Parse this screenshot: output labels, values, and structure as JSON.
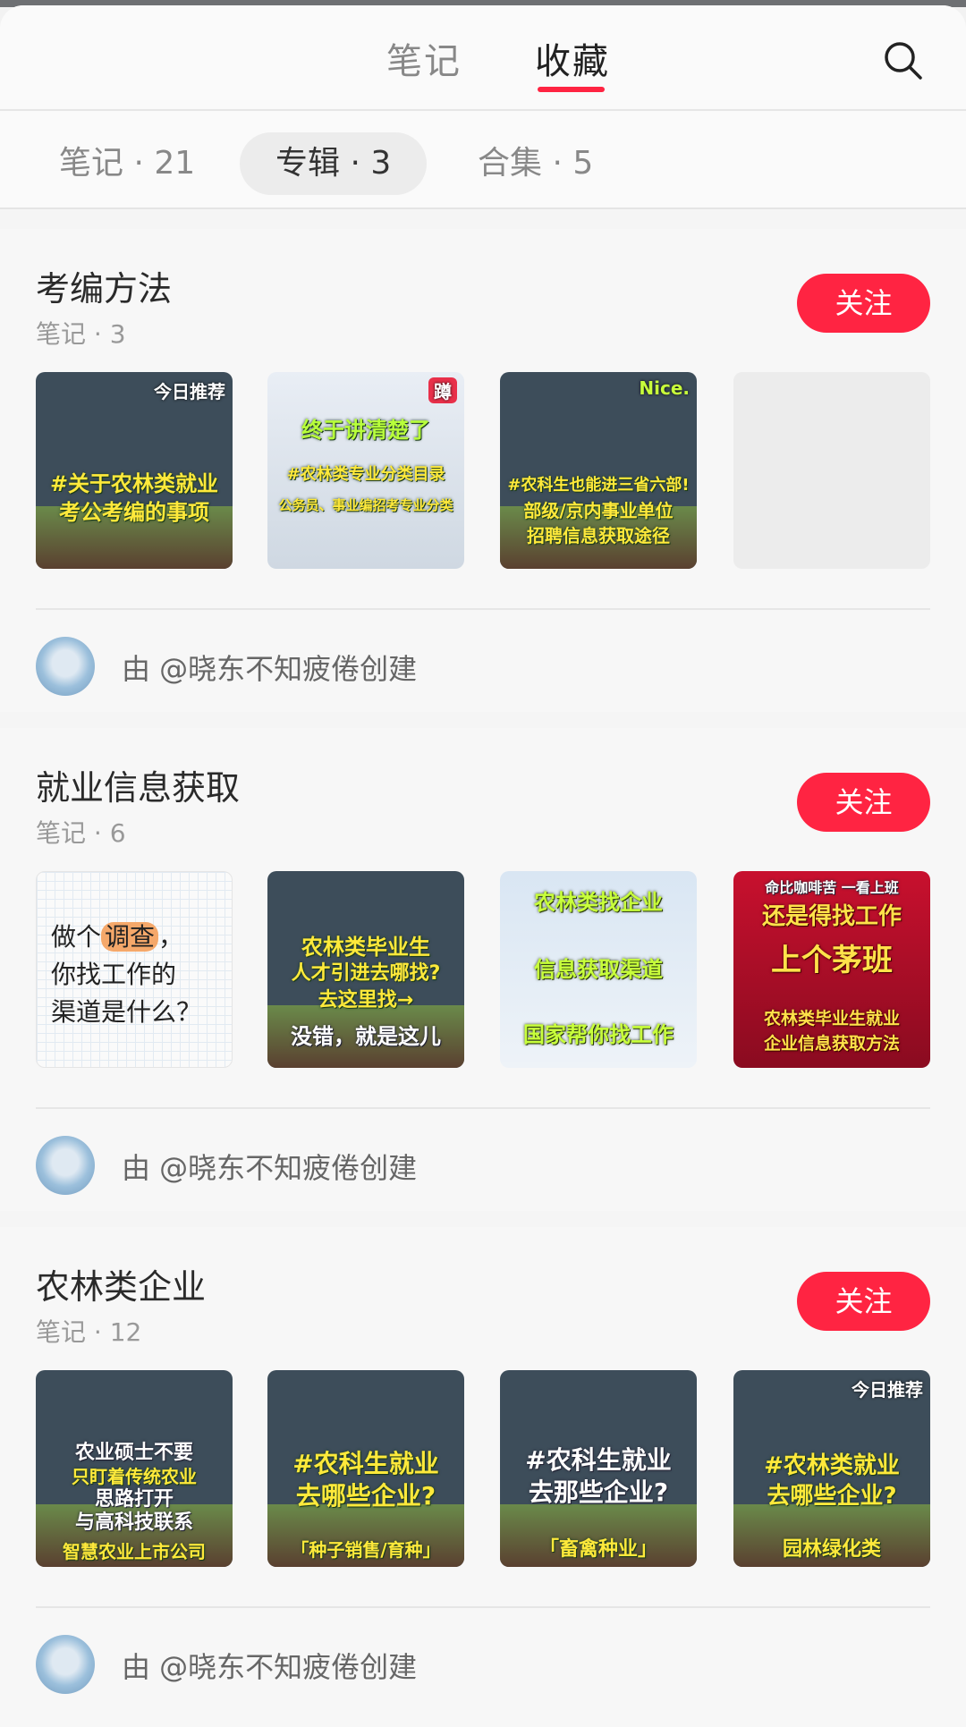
{
  "header": {
    "tabs": [
      {
        "label": "笔记",
        "active": false
      },
      {
        "label": "收藏",
        "active": true
      }
    ],
    "search_icon": "search-icon",
    "accent": "#ff2442"
  },
  "subtabs": [
    {
      "label": "笔记 · 21",
      "active": false
    },
    {
      "label": "专辑 · 3",
      "active": true
    },
    {
      "label": "合集 · 5",
      "active": false
    }
  ],
  "albums": [
    {
      "title": "考编方法",
      "count": "笔记 · 3",
      "follow": "关注",
      "creator": "由 @晓东不知疲倦创建",
      "thumbs": [
        {
          "tag": "今日推荐",
          "lines": [
            "#关于农林类就业",
            "考公考编的事项"
          ]
        },
        {
          "tag": "蹲",
          "lines": [
            "终于讲清楚了",
            "#农林类专业分类目录",
            "公务员、事业编招考专业分类"
          ]
        },
        {
          "tag": "Nice.",
          "lines": [
            "#农科生也能进三省六部!",
            "部级/京内事业单位",
            "招聘信息获取途径"
          ]
        },
        {
          "empty": true
        }
      ]
    },
    {
      "title": "就业信息获取",
      "count": "笔记 · 6",
      "follow": "关注",
      "creator": "由 @晓东不知疲倦创建",
      "thumbs": [
        {
          "survey": [
            "做个",
            "调查",
            "，",
            "你找工作的",
            "渠道是什么？"
          ]
        },
        {
          "lines": [
            "农林类毕业生",
            "人才引进去哪找?",
            "去这里找→",
            "没错，就是这儿"
          ]
        },
        {
          "lines": [
            "农林类找企业",
            "信息获取渠道",
            "国家帮你找工作"
          ]
        },
        {
          "tag": "命比咖啡苦 一看上班",
          "lines": [
            "还是得找工作",
            "上个茅班",
            "农林类毕业生就业",
            "企业信息获取方法"
          ]
        }
      ]
    },
    {
      "title": "农林类企业",
      "count": "笔记 · 12",
      "follow": "关注",
      "creator": "由 @晓东不知疲倦创建",
      "thumbs": [
        {
          "lines": [
            "农业硕士不要",
            "只盯着传统农业",
            "思路打开",
            "与高科技联系",
            "智慧农业上市公司"
          ]
        },
        {
          "lines": [
            "#农科生就业",
            "去哪些企业?",
            "「种子销售/育种」"
          ]
        },
        {
          "lines": [
            "#农科生就业",
            "去那些企业?",
            "「畜禽种业」"
          ]
        },
        {
          "tag": "今日推荐",
          "lines": [
            "#农林类就业",
            "去哪些企业?",
            "园林绿化类"
          ]
        }
      ]
    }
  ]
}
